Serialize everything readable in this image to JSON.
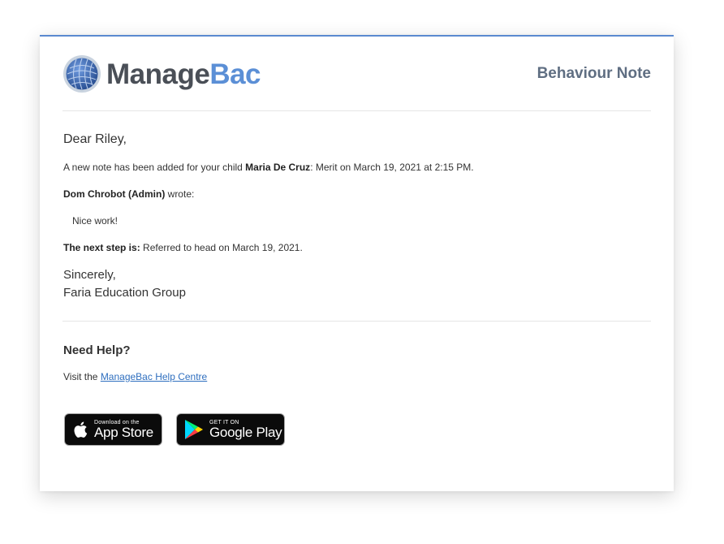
{
  "brand": {
    "name_part1": "Manage",
    "name_part2": "Bac",
    "accent_color": "#5b8fd6",
    "logo_icon": "globe-icon"
  },
  "header": {
    "title": "Behaviour Note"
  },
  "message": {
    "greeting": "Dear Riley,",
    "intro_prefix": "A new note has been added for your child ",
    "child_name": "Maria De Cruz",
    "intro_suffix": ": Merit on March 19, 2021 at 2:15 PM.",
    "author": "Dom Chrobot (Admin)",
    "author_suffix": " wrote:",
    "note": "Nice work!",
    "next_step_label": "The next step is:",
    "next_step_text": " Referred to head on March 19, 2021.",
    "signoff": "Sincerely,",
    "signature": "Faria Education Group"
  },
  "help": {
    "title": "Need Help?",
    "visit_prefix": "Visit the ",
    "link_text": "ManageBac Help Centre"
  },
  "app_store": {
    "small": "Download on the",
    "big": "App Store",
    "icon": "apple-icon"
  },
  "google_play": {
    "small": "GET IT ON",
    "big": "Google Play",
    "icon": "google-play-icon"
  }
}
